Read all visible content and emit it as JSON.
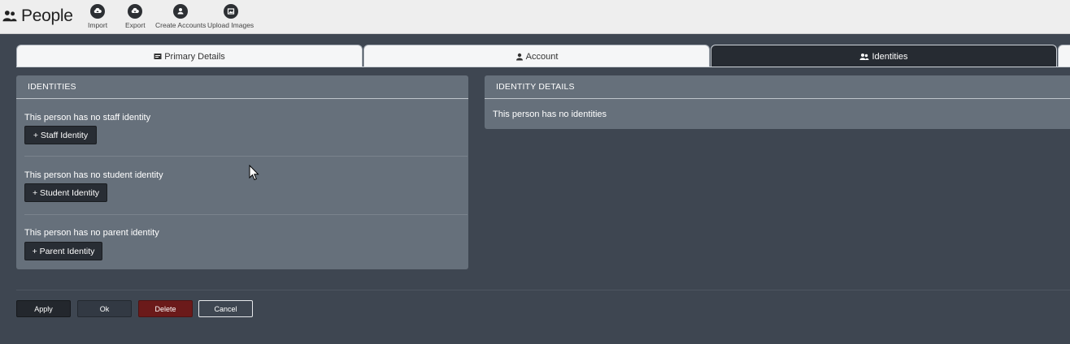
{
  "header": {
    "title": "People",
    "title_icon": "people-icon",
    "tools": [
      {
        "label": "Import",
        "icon": "cloud-upload-icon"
      },
      {
        "label": "Export",
        "icon": "cloud-download-icon"
      },
      {
        "label": "Create Accounts",
        "icon": "user-add-icon"
      },
      {
        "label": "Upload Images",
        "icon": "image-icon"
      }
    ]
  },
  "tabs": [
    {
      "label": "Primary Details",
      "icon": "id-card-icon",
      "active": false
    },
    {
      "label": "Account",
      "icon": "user-icon",
      "active": false
    },
    {
      "label": "Identities",
      "icon": "users-icon",
      "active": true
    }
  ],
  "identities_panel": {
    "title": "IDENTITIES",
    "sections": [
      {
        "text": "This person has no staff identity",
        "button": "+ Staff Identity"
      },
      {
        "text": "This person has no student identity",
        "button": "+ Student Identity"
      },
      {
        "text": "This person has no parent identity",
        "button": "+ Parent Identity"
      }
    ]
  },
  "details_panel": {
    "title": "IDENTITY DETAILS",
    "text": "This person has no identities"
  },
  "footer": {
    "apply": "Apply",
    "ok": "Ok",
    "delete": "Delete",
    "cancel": "Cancel"
  },
  "colors": {
    "background": "#3e4651",
    "panel": "#66707b",
    "active_tab": "#262b32",
    "delete_button": "#6b1a1a"
  }
}
